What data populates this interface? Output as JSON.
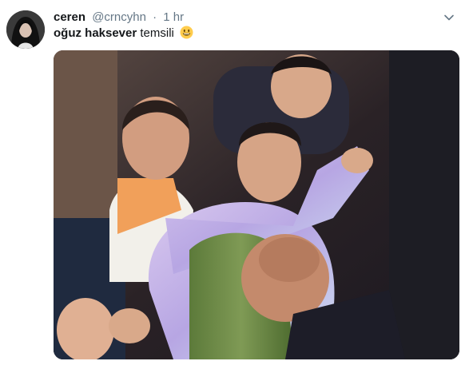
{
  "tweet": {
    "author": {
      "name": "ceren",
      "handle": "@crncyhn",
      "separator": "·",
      "time": "1 hr"
    },
    "text": {
      "mention": "oğuz haksever",
      "rest": " temsili",
      "emoji": "smiling-face-icon"
    },
    "media": {
      "kind": "photo"
    }
  },
  "colors": {
    "text": "#14171a",
    "secondary": "#657786",
    "emoji": "#ffcc4d"
  }
}
